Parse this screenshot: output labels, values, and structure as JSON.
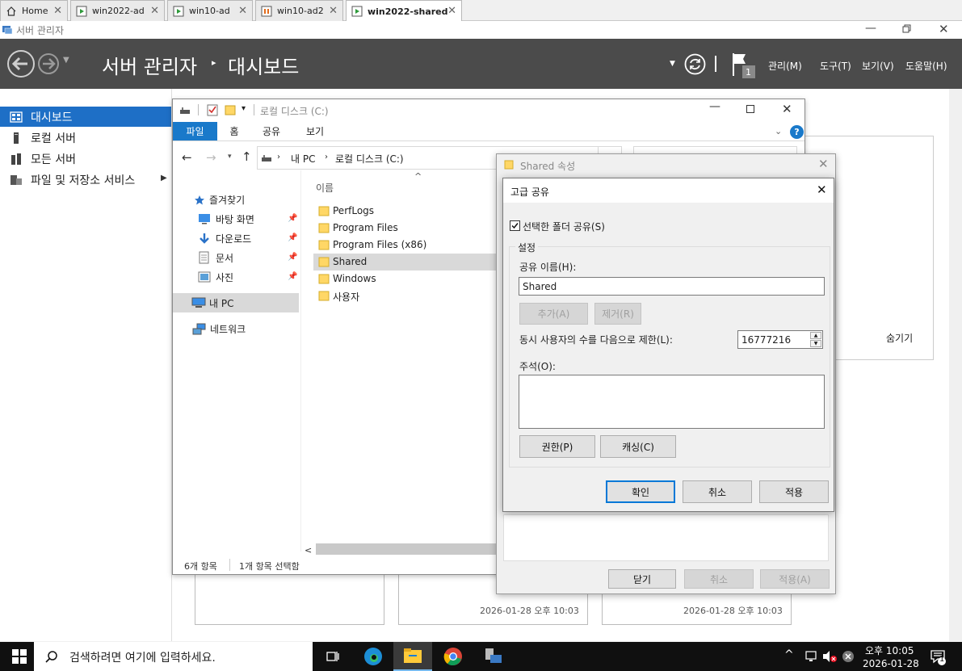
{
  "host_tabs": [
    {
      "label": "Home",
      "icon": "home-icon"
    },
    {
      "label": "win2022-ad",
      "icon": "vm-running-icon"
    },
    {
      "label": "win10-ad",
      "icon": "vm-running-icon"
    },
    {
      "label": "win10-ad2",
      "icon": "vm-paused-icon"
    },
    {
      "label": "win2022-shared",
      "icon": "vm-running-icon"
    }
  ],
  "server_manager": {
    "window_title": "서버 관리자",
    "breadcrumb_root": "서버 관리자",
    "breadcrumb_page": "대시보드",
    "flag_badge": "1",
    "menu": [
      "관리(M)",
      "도구(T)",
      "보기(V)",
      "도움말(H)"
    ],
    "nav": [
      {
        "label": "대시보드",
        "icon": "dashboard-icon"
      },
      {
        "label": "로컬 서버",
        "icon": "server-icon"
      },
      {
        "label": "모든 서버",
        "icon": "servers-icon"
      },
      {
        "label": "파일 및 저장소 서비스",
        "icon": "storage-icon"
      }
    ],
    "hide_label": "숨기기",
    "tiles": [
      {
        "timestamp": ""
      },
      {
        "timestamp": "2026-01-28 오후 10:03"
      },
      {
        "timestamp": "2026-01-28 오후 10:03"
      }
    ]
  },
  "explorer": {
    "title": "로컬 디스크 (C:)",
    "ribbon_tabs": [
      "파일",
      "홈",
      "공유",
      "보기"
    ],
    "address": [
      "내 PC",
      "로컬 디스크 (C:)"
    ],
    "column_header": "이름",
    "nav_pane": {
      "quick_access": "즐겨찾기",
      "pinned": [
        {
          "label": "바탕 화면",
          "icon": "desktop-icon"
        },
        {
          "label": "다운로드",
          "icon": "download-icon"
        },
        {
          "label": "문서",
          "icon": "document-icon"
        },
        {
          "label": "사진",
          "icon": "pictures-icon"
        }
      ],
      "this_pc": "내 PC",
      "network": "네트워크"
    },
    "files": [
      "PerfLogs",
      "Program Files",
      "Program Files (x86)",
      "Shared",
      "Windows",
      "사용자"
    ],
    "selected_file": "Shared",
    "status_count": "6개 항목",
    "status_selected": "1개 항목 선택함"
  },
  "properties": {
    "title": "Shared 속성",
    "buttons": {
      "close": "닫기",
      "cancel": "취소",
      "apply": "적용(A)"
    }
  },
  "advanced_sharing": {
    "title": "고급 공유",
    "share_checkbox_label": "선택한 폴더 공유(S)",
    "share_checked": true,
    "settings_group": "설정",
    "share_name_label": "공유 이름(H):",
    "share_name_value": "Shared",
    "add_button": "추가(A)",
    "remove_button": "제거(R)",
    "limit_label": "동시 사용자의 수를 다음으로 제한(L):",
    "limit_value": "16777216",
    "comment_label": "주석(O):",
    "comment_value": "",
    "permissions_button": "권한(P)",
    "caching_button": "캐싱(C)",
    "ok_button": "확인",
    "cancel_button": "취소",
    "apply_button": "적용"
  },
  "taskbar": {
    "search_placeholder": "검색하려면 여기에 입력하세요.",
    "time": "오후 10:05",
    "date": "2026-01-28",
    "notification_count": "1",
    "colors": {
      "accent": "#0078d7",
      "nav_selected": "#1e6fc6",
      "header": "#4b4b4b"
    }
  }
}
